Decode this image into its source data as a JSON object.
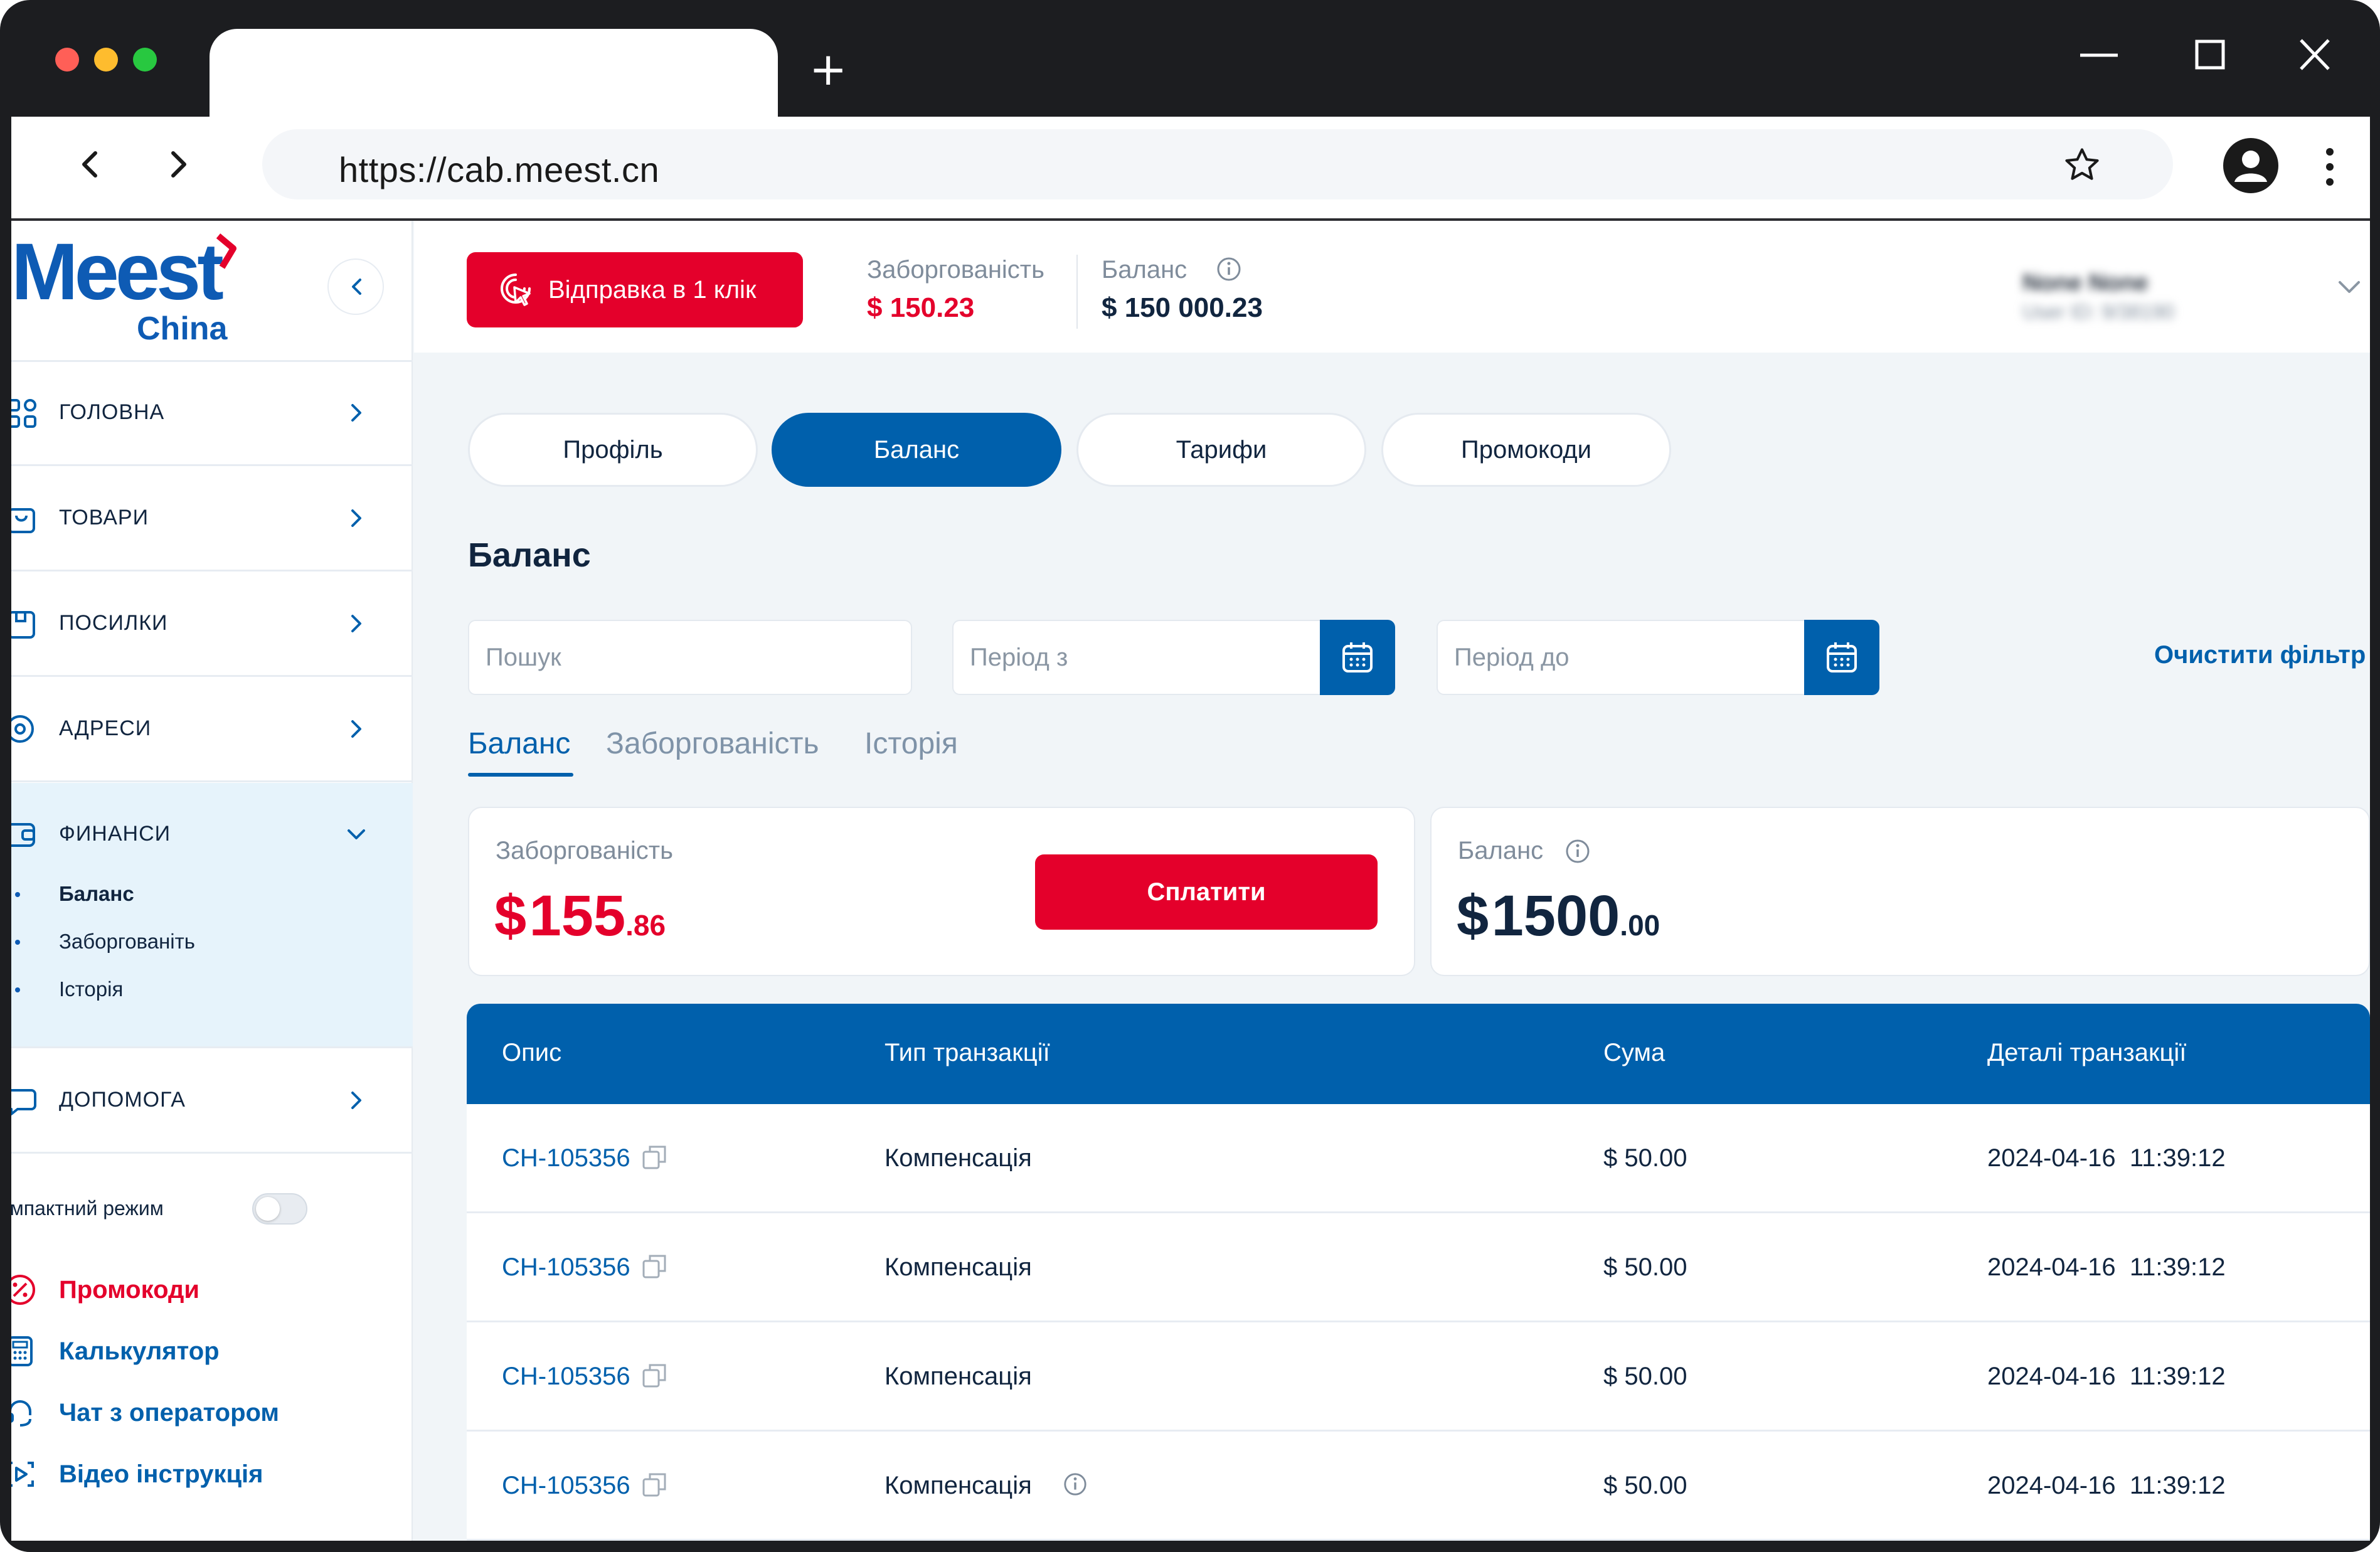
{
  "browser": {
    "url": "https://cab.meest.cn",
    "new_tab_symbol": "+"
  },
  "sidebar": {
    "logo_main": "Meest",
    "logo_sub": "China",
    "items": [
      {
        "label": "ГОЛОВНА",
        "icon": "grid-icon"
      },
      {
        "label": "ТОВАРИ",
        "icon": "bag-icon"
      },
      {
        "label": "ПОСИЛКИ",
        "icon": "box-icon"
      },
      {
        "label": "АДРЕСИ",
        "icon": "location-icon"
      },
      {
        "label": "ФИНАНСИ",
        "icon": "wallet-icon"
      },
      {
        "label": "ДОПОМОГА",
        "icon": "chat-icon"
      }
    ],
    "finance_sub": [
      "Баланс",
      "Заборгованіть",
      "Історія"
    ],
    "compact_mode_label": "омпактний режим",
    "links": [
      {
        "label": "Промокоди",
        "color": "#e4002b",
        "icon": "percent-icon"
      },
      {
        "label": "Калькулятор",
        "color": "#0060ac",
        "icon": "calculator-icon"
      },
      {
        "label": "Чат з оператором",
        "color": "#0060ac",
        "icon": "headset-icon"
      },
      {
        "label": "Відео інструкція",
        "color": "#0060ac",
        "icon": "video-icon"
      }
    ]
  },
  "header": {
    "send_button": "Відправка в 1 клік",
    "debt_label": "Заборгованість",
    "debt_value": "$ 150.23",
    "balance_label": "Баланс",
    "balance_value": "$ 150 000.23",
    "user_name": "None None",
    "user_id": "User ID: 9/38190"
  },
  "tabs": [
    "Профіль",
    "Баланс",
    "Тарифи",
    "Промокоди"
  ],
  "active_tab": 1,
  "page_title": "Баланс",
  "filters": {
    "search_placeholder": "Пошук",
    "period_from_placeholder": "Період з",
    "period_to_placeholder": "Період до",
    "clear": "Очистити фільтр"
  },
  "subtabs": [
    "Баланс",
    "Заборгованість",
    "Історія"
  ],
  "active_subtab": 0,
  "cards": {
    "debt": {
      "label": "Заборгованість",
      "currency": "$",
      "whole": "155",
      "cents": ".86",
      "pay_button": "Сплатити"
    },
    "balance": {
      "label": "Баланс",
      "currency": "$",
      "whole": "1500",
      "cents": ".00"
    }
  },
  "table": {
    "headers": [
      "Опис",
      "Тип транзакції",
      "Сума",
      "Деталі транзакції"
    ],
    "rows": [
      {
        "id": "CH-105356",
        "type": "Компенсація",
        "amount": "$ 50.00",
        "details": "2024-04-16  11:39:12",
        "info": false
      },
      {
        "id": "CH-105356",
        "type": "Компенсація",
        "amount": "$ 50.00",
        "details": "2024-04-16  11:39:12",
        "info": false
      },
      {
        "id": "CH-105356",
        "type": "Компенсація",
        "amount": "$ 50.00",
        "details": "2024-04-16  11:39:12",
        "info": false
      },
      {
        "id": "CH-105356",
        "type": "Компенсація",
        "amount": "$ 50.00",
        "details": "2024-04-16  11:39:12",
        "info": true
      }
    ]
  },
  "colors": {
    "brand_blue": "#0060ac",
    "brand_red": "#e4002b",
    "text_dark": "#11253f"
  }
}
